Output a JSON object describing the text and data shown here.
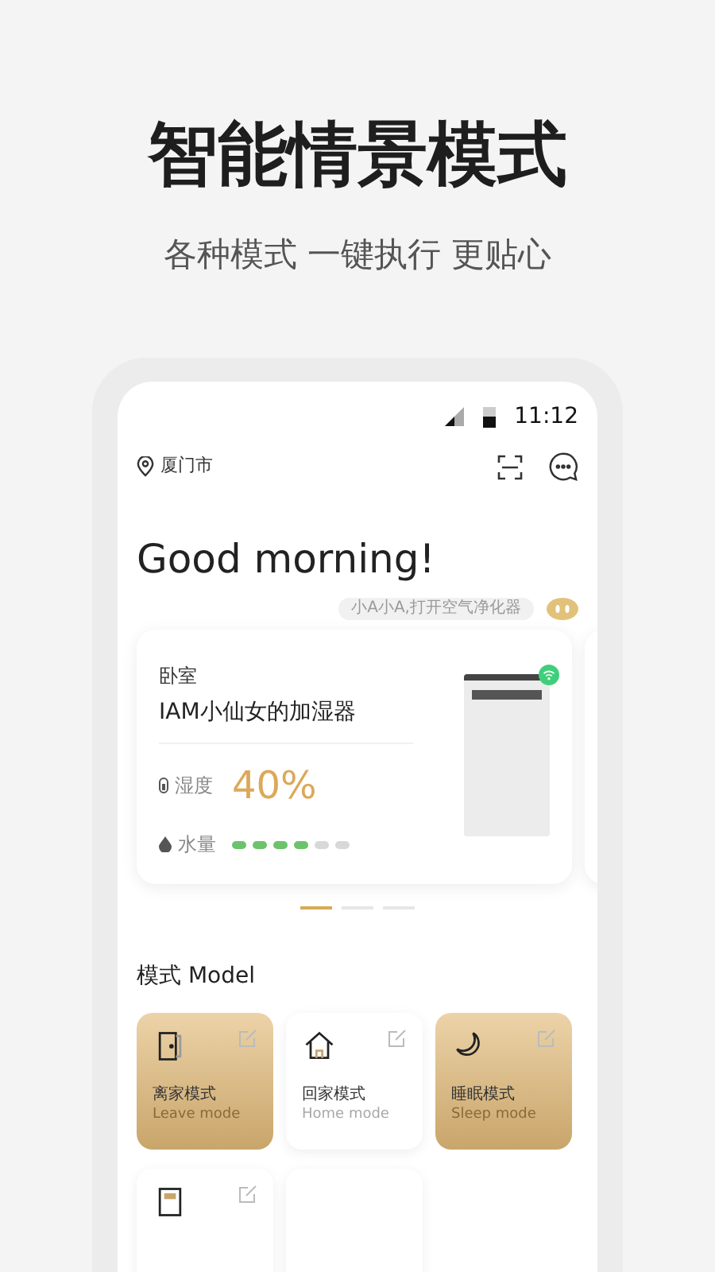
{
  "headline": "智能情景模式",
  "subtitle": "各种模式 一键执行 更贴心",
  "status_bar": {
    "time": "11:12"
  },
  "location": "厦门市",
  "greeting": "Good morning!",
  "voice_hint": "小A小A,打开空气净化器",
  "device_card": {
    "room": "卧室",
    "name": "IAM小仙女的加湿器",
    "humidity_label": "湿度",
    "humidity_value": "40%",
    "water_label": "水量",
    "level": 0.67,
    "online": true
  },
  "carousel_dots": [
    {
      "selected": true
    },
    {
      "selected": false
    },
    {
      "selected": false
    }
  ],
  "modes_title": "模式 Model",
  "modes": [
    {
      "kind": "door",
      "label": "离家模式",
      "sublabel": "Leave mode",
      "active": true
    },
    {
      "kind": "house",
      "label": "回家模式",
      "sublabel": "Home mode",
      "active": false
    },
    {
      "kind": "moon",
      "label": "睡眠模式",
      "sublabel": "Sleep mode",
      "active": true
    },
    {
      "kind": "tablet",
      "active": false
    },
    {
      "kind": "blank",
      "active": false
    }
  ]
}
